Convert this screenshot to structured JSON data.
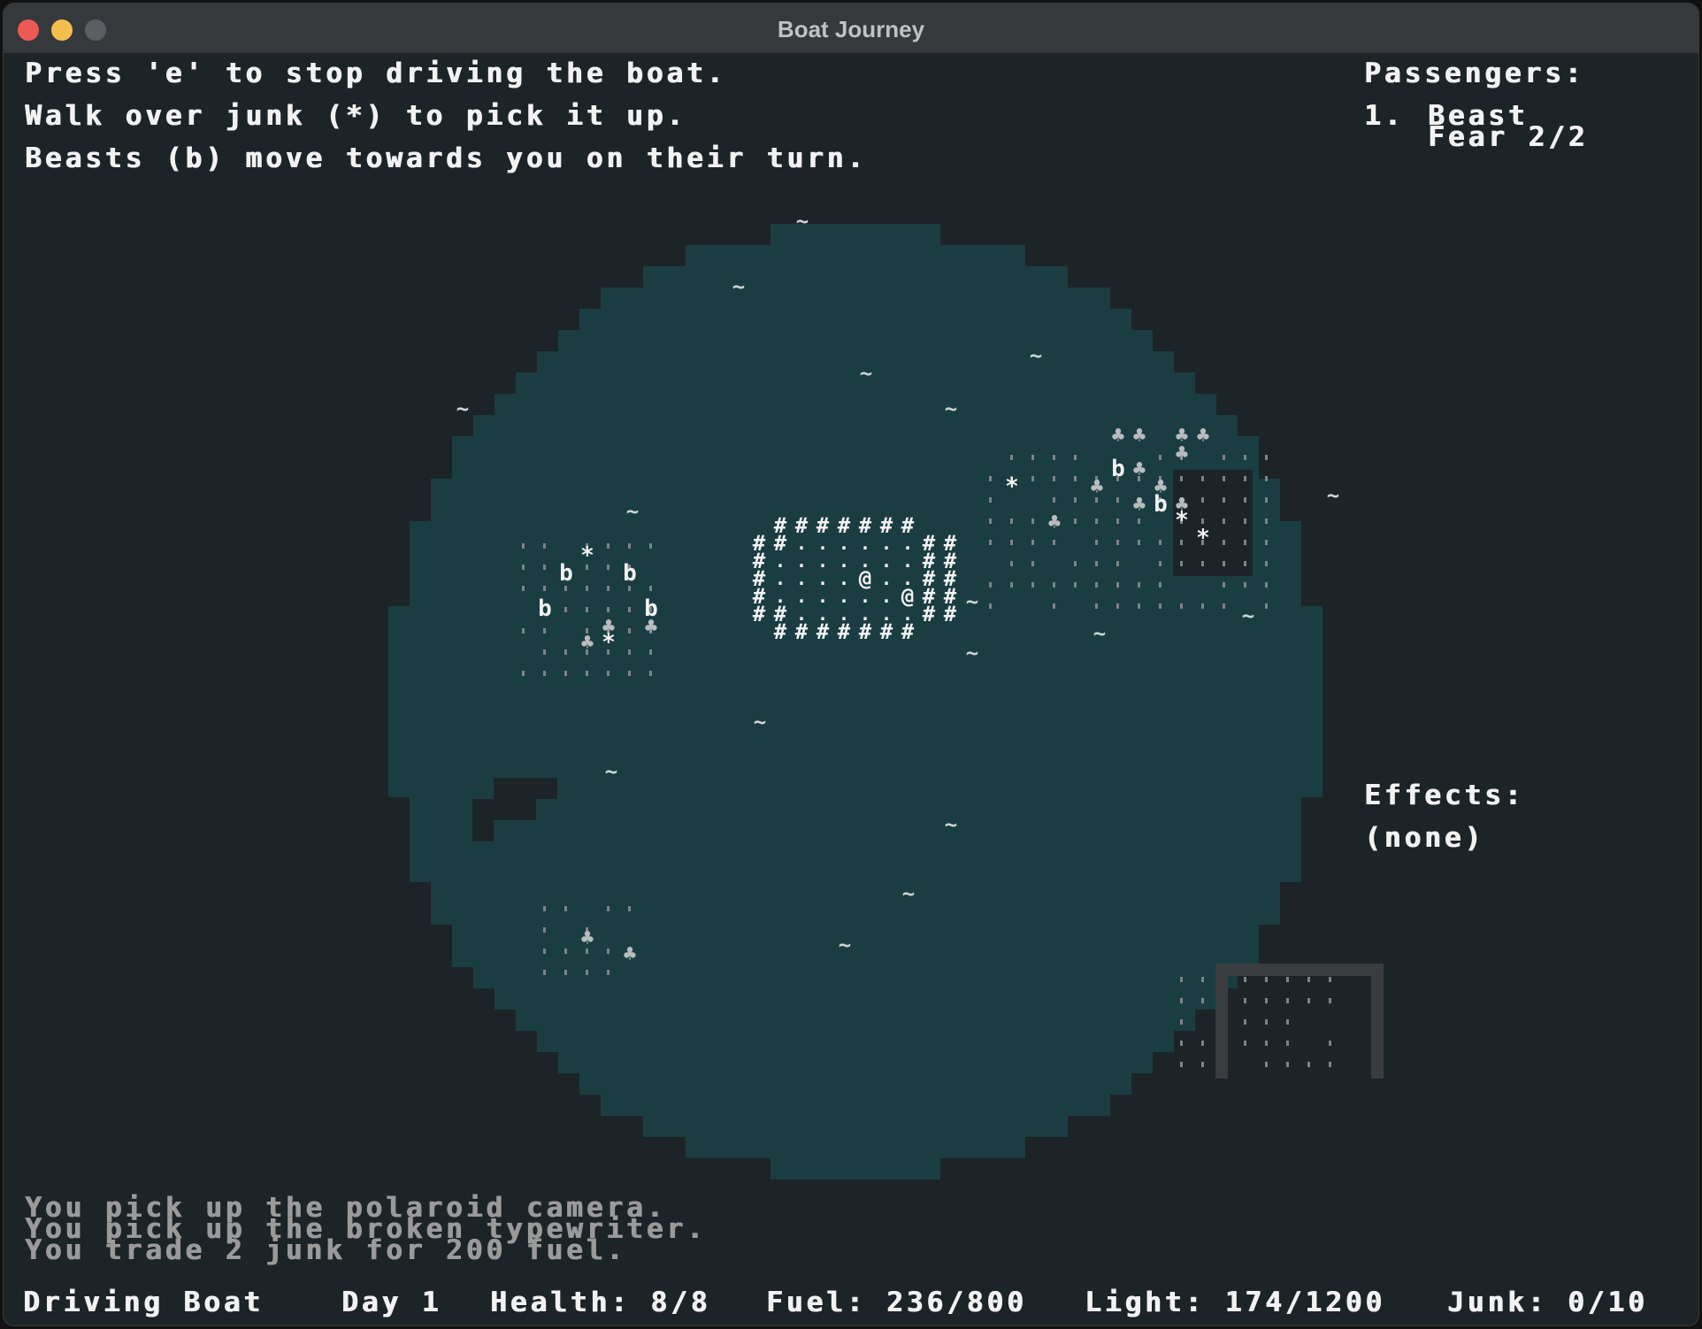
{
  "window": {
    "title": "Boat Journey"
  },
  "instructions": [
    "Press 'e' to stop driving the boat.",
    "Walk over junk (*) to pick it up.",
    "Beasts (b) move towards you on their turn."
  ],
  "passengers": {
    "heading": "Passengers:",
    "items": [
      {
        "number": "1.",
        "name": "Beast",
        "detail": "Fear 2/2"
      }
    ]
  },
  "effects": {
    "heading": "Effects:",
    "value": "(none)"
  },
  "log": [
    "You pick up the polaroid camera.",
    "You pick up the broken typewriter.",
    "You trade 2 junk for 200 fuel."
  ],
  "status": {
    "mode": "Driving Boat",
    "day": "Day 1",
    "health": "Health: 8/8",
    "fuel": "Fuel: 236/800",
    "light": "Light: 174/1200",
    "junk": "Junk: 0/10"
  },
  "colors": {
    "background": "#1d2427",
    "water": "#1a3d42",
    "text": "#f2f2f2",
    "dim_text": "#9a9a9a",
    "land_dot": "#7d8486"
  },
  "map_glyphs": {
    "boat_wall": "#",
    "boat_floor": ".",
    "player": "@",
    "beast": "b",
    "junk": "*",
    "tree": "♣",
    "wave": "~"
  }
}
